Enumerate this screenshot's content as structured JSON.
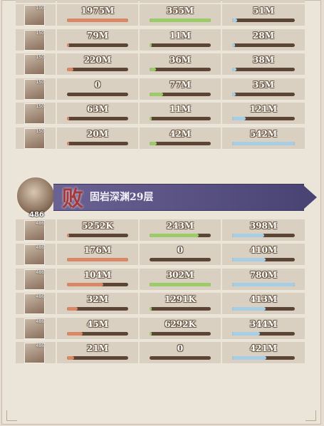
{
  "top_team": [
    {
      "level": "100",
      "dmg": "1975M",
      "dmg_fill": 1.0,
      "taken": "355M",
      "taken_fill": 1.0,
      "heal": "51M",
      "heal_fill": 0.08
    },
    {
      "level": "150",
      "dmg": "79M",
      "dmg_fill": 0.04,
      "taken": "11M",
      "taken_fill": 0.03,
      "heal": "28M",
      "heal_fill": 0.05
    },
    {
      "level": "150",
      "dmg": "220M",
      "dmg_fill": 0.11,
      "taken": "36M",
      "taken_fill": 0.1,
      "heal": "38M",
      "heal_fill": 0.07
    },
    {
      "level": "150",
      "dmg": "0",
      "dmg_fill": 0.0,
      "taken": "77M",
      "taken_fill": 0.22,
      "heal": "35M",
      "heal_fill": 0.06
    },
    {
      "level": "150",
      "dmg": "63M",
      "dmg_fill": 0.03,
      "taken": "11M",
      "taken_fill": 0.03,
      "heal": "121M",
      "heal_fill": 0.22
    },
    {
      "level": "150",
      "dmg": "20M",
      "dmg_fill": 0.01,
      "taken": "42M",
      "taken_fill": 0.12,
      "heal": "542M",
      "heal_fill": 1.0
    }
  ],
  "opponent": {
    "result": "败",
    "stage": "固岩深渊29层",
    "level": "486"
  },
  "bottom_team": [
    {
      "level": "486",
      "dmg": "5252K",
      "dmg_fill": 0.03,
      "taken": "243M",
      "taken_fill": 0.8,
      "heal": "398M",
      "heal_fill": 0.51
    },
    {
      "level": "486",
      "dmg": "176M",
      "dmg_fill": 1.0,
      "taken": "0",
      "taken_fill": 0.0,
      "heal": "410M",
      "heal_fill": 0.53
    },
    {
      "level": "486",
      "dmg": "104M",
      "dmg_fill": 0.59,
      "taken": "302M",
      "taken_fill": 1.0,
      "heal": "780M",
      "heal_fill": 1.0
    },
    {
      "level": "486",
      "dmg": "32M",
      "dmg_fill": 0.18,
      "taken": "1291K",
      "taken_fill": 0.01,
      "heal": "413M",
      "heal_fill": 0.53
    },
    {
      "level": "486",
      "dmg": "45M",
      "dmg_fill": 0.26,
      "taken": "6292K",
      "taken_fill": 0.02,
      "heal": "344M",
      "heal_fill": 0.44
    },
    {
      "level": "486",
      "dmg": "21M",
      "dmg_fill": 0.12,
      "taken": "0",
      "taken_fill": 0.0,
      "heal": "421M",
      "heal_fill": 0.54
    }
  ],
  "colors": {
    "damage": "#d98764",
    "taken": "#9ccc6a",
    "heal": "#a6cfe6",
    "banner": "#4a4475",
    "result": "#a33a3f"
  }
}
